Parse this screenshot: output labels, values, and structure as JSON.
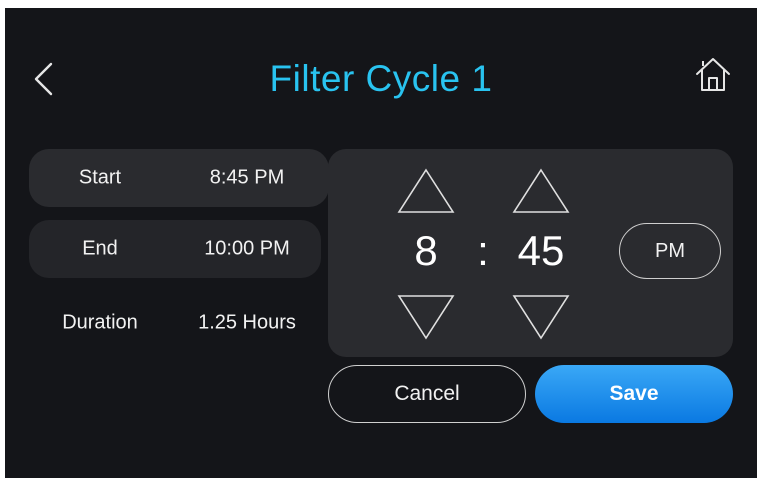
{
  "header": {
    "title": "Filter Cycle 1",
    "back_icon": "chevron-left-icon",
    "home_icon": "home-icon"
  },
  "schedule": {
    "start": {
      "label": "Start",
      "value": "8:45 PM"
    },
    "end": {
      "label": "End",
      "value": "10:00 PM"
    },
    "duration": {
      "label": "Duration",
      "value": "1.25 Hours"
    }
  },
  "time_picker": {
    "hour": "8",
    "separator": ":",
    "minute": "45",
    "period": "PM",
    "up_icon": "triangle-up-icon",
    "down_icon": "triangle-down-icon"
  },
  "actions": {
    "cancel_label": "Cancel",
    "save_label": "Save"
  },
  "colors": {
    "background": "#141519",
    "panel": "#2a2b2f",
    "title": "#29c3f0",
    "save_button": "#1a8cee"
  }
}
